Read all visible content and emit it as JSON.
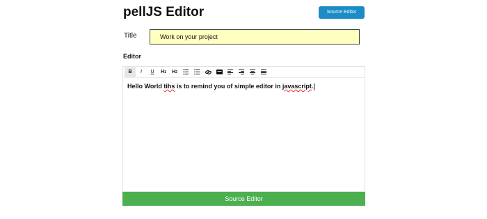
{
  "header": {
    "title": "pellJS Editor",
    "source_button_label": "Source Editor"
  },
  "form": {
    "title_label": "Title",
    "title_value": "Work on your project",
    "editor_label": "Editor"
  },
  "toolbar": {
    "items": [
      {
        "name": "bold",
        "label": "B",
        "active": true
      },
      {
        "name": "italic",
        "label": "I"
      },
      {
        "name": "underline",
        "label": "U"
      },
      {
        "name": "heading1",
        "label": "H",
        "sub": "1"
      },
      {
        "name": "heading2",
        "label": "H",
        "sub": "2"
      },
      {
        "name": "ordered-list",
        "icon": "ordered-list-icon"
      },
      {
        "name": "unordered-list",
        "icon": "unordered-list-icon"
      },
      {
        "name": "link",
        "icon": "link-icon"
      },
      {
        "name": "image",
        "icon": "image-icon"
      },
      {
        "name": "align-left",
        "icon": "align-left-icon"
      },
      {
        "name": "align-right",
        "icon": "align-right-icon"
      },
      {
        "name": "align-center",
        "icon": "align-center-icon"
      },
      {
        "name": "justify",
        "icon": "justify-icon"
      }
    ]
  },
  "editor": {
    "text_part1": "Hello World ",
    "misspelled1": "tihs",
    "text_part2": " is to remind you of simple editor in ",
    "misspelled2": "javascript",
    "text_part3": "."
  },
  "footer": {
    "source_button_label": "Source Editor"
  },
  "colors": {
    "top_button": "#1b8cc6",
    "bottom_button": "#4caf50",
    "title_input_bg": "#ffffc0"
  }
}
